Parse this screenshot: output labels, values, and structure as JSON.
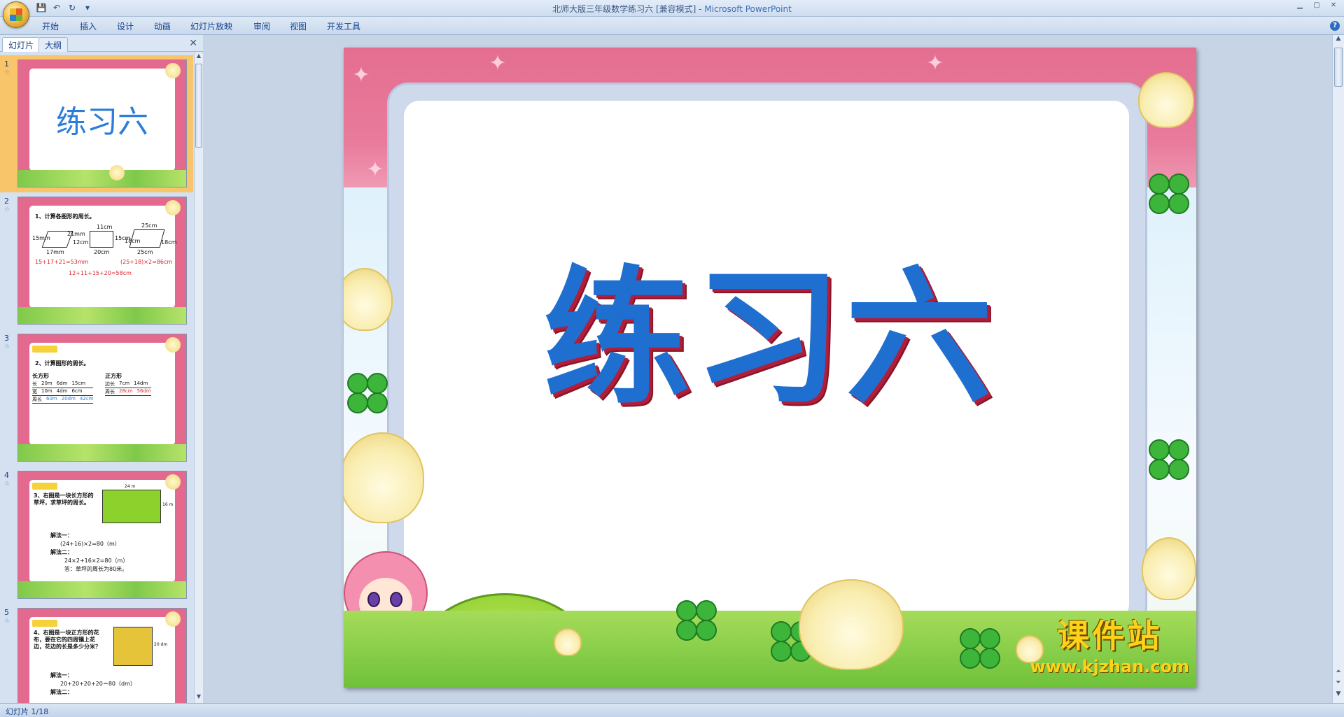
{
  "window": {
    "title_doc": "北师大版三年级数学练习六 [兼容模式]",
    "title_app": "Microsoft PowerPoint"
  },
  "ribbon": {
    "tabs": [
      "开始",
      "插入",
      "设计",
      "动画",
      "幻灯片放映",
      "审阅",
      "视图",
      "开发工具"
    ]
  },
  "left_pane": {
    "tab_slides": "幻灯片",
    "tab_outline": "大纲",
    "thumbnails": [
      {
        "num": "1",
        "title": "练习六"
      },
      {
        "num": "2",
        "heading": "1、计算各图形的周长。",
        "labels": [
          "11cm",
          "21mm",
          "15mm",
          "17mm",
          "12cm",
          "15cm",
          "20cm",
          "25cm",
          "18cm",
          "18cm",
          "25cm"
        ],
        "eq1": "15+17+21=53mm",
        "eq2": "(25+18)×2=86cm",
        "eq3": "12+11+15+20=58cm"
      },
      {
        "num": "3",
        "heading": "2、计算图形的周长。",
        "rect_title": "长方形",
        "square_title": "正方形",
        "row_long": [
          "长",
          "20m",
          "6dm",
          "15cm"
        ],
        "row_wide": [
          "宽",
          "10m",
          "4dm",
          "6cm"
        ],
        "row_peri": [
          "周长",
          "60m",
          "20dm",
          "42cm"
        ],
        "sq_side": [
          "边长",
          "7cm",
          "14dm"
        ],
        "sq_peri": [
          "周长",
          "28cm",
          "56dm"
        ]
      },
      {
        "num": "4",
        "text": "3、右图是一块长方形的草坪，求草坪的周长。",
        "method1": "解法一：",
        "eq1": "(24+16)×2=80（m）",
        "method2": "解法二：",
        "eq2": "24×2+16×2=80（m）",
        "answer": "答：草坪的周长为80米。",
        "dim_top": "24 m",
        "dim_side": "16 m"
      },
      {
        "num": "5",
        "text": "4、右图是一块正方形的花布，要在它的四周镶上花边，花边的长是多少分米？",
        "method1": "解法一：",
        "eq1": "20+20+20+20＝80（dm）",
        "method2": "解法二：",
        "dim_side": "20 dm"
      }
    ]
  },
  "slide": {
    "title": "练习六",
    "watermark_cn": "课件站",
    "watermark_url": "www.kjzhan.com"
  },
  "status": {
    "slide_counter": "幻灯片 1/18"
  },
  "colors": {
    "title_blue": "#1f6fd1",
    "title_shadow": "#b01e3a",
    "slide_pink": "#e3688b",
    "selected_thumb": "#f9c56a"
  }
}
